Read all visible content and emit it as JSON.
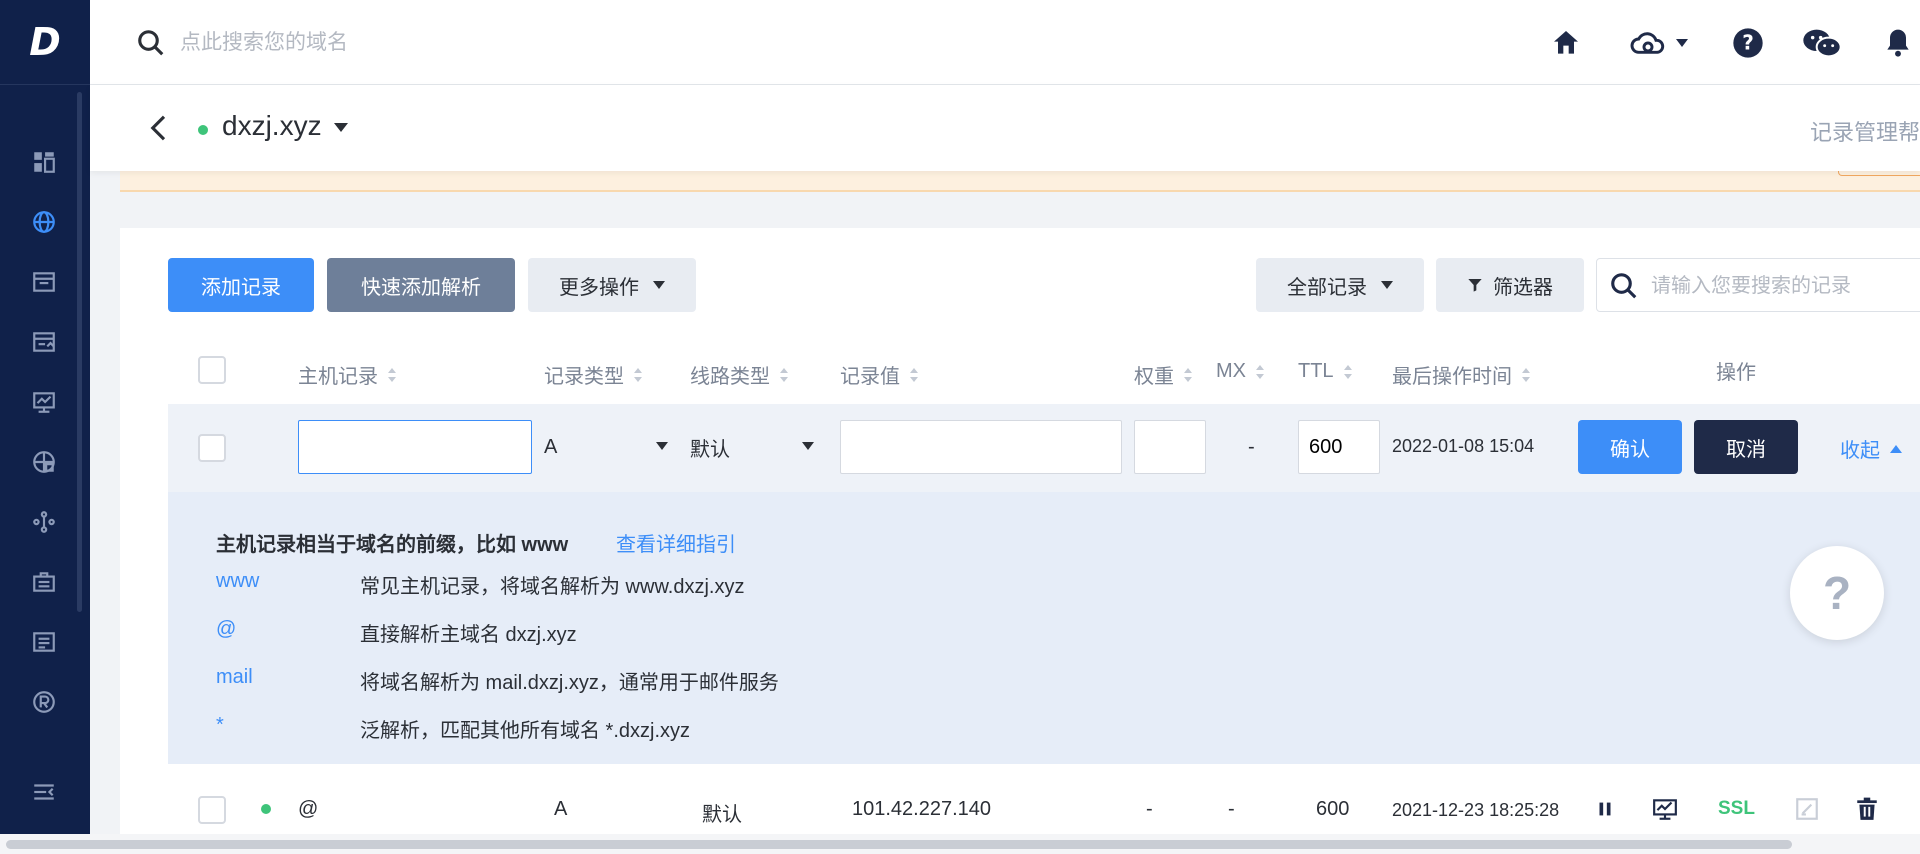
{
  "app": {
    "logo_letter": "D"
  },
  "topbar": {
    "search_placeholder": "点此搜索您的域名"
  },
  "sidebar": {
    "items": [
      {
        "icon": "dashboard-icon",
        "active": false
      },
      {
        "icon": "globe-icon",
        "active": true
      },
      {
        "icon": "window-icon",
        "active": false
      },
      {
        "icon": "browser-icon",
        "active": false
      },
      {
        "icon": "monitor-icon",
        "active": false
      },
      {
        "icon": "global-network-icon",
        "active": false
      },
      {
        "icon": "nodes-icon",
        "active": false
      },
      {
        "icon": "briefcase-icon",
        "active": false
      },
      {
        "icon": "document-icon",
        "active": false
      },
      {
        "icon": "registered-icon",
        "active": false
      },
      {
        "icon": "collapse-menu-icon",
        "active": false
      }
    ]
  },
  "domain": {
    "name": "dxzj.xyz",
    "help": "记录管理帮"
  },
  "toolbar": {
    "add_record": "添加记录",
    "quick_add": "快速添加解析",
    "more_actions": "更多操作",
    "all_records": "全部记录",
    "filter": "筛选器",
    "search_placeholder": "请输入您要搜索的记录"
  },
  "table": {
    "headers": {
      "host": "主机记录",
      "type": "记录类型",
      "line": "线路类型",
      "value": "记录值",
      "weight": "权重",
      "mx": "MX",
      "ttl": "TTL",
      "time": "最后操作时间",
      "actions": "操作"
    },
    "edit_row": {
      "host": "",
      "type": "A",
      "line": "默认",
      "value": "",
      "weight": "",
      "mx": "-",
      "ttl": "600",
      "time": "2022-01-08 15:04",
      "confirm": "确认",
      "cancel": "取消",
      "collapse": "收起"
    },
    "guide": {
      "title": "主机记录相当于域名的前缀，比如 www",
      "link": "查看详细指引",
      "rows": [
        {
          "key": "www",
          "desc": "常见主机记录，将域名解析为 www.dxzj.xyz"
        },
        {
          "key": "@",
          "desc": "直接解析主域名 dxzj.xyz"
        },
        {
          "key": "mail",
          "desc": "将域名解析为 mail.dxzj.xyz，通常用于邮件服务"
        },
        {
          "key": "*",
          "desc": "泛解析，匹配其他所有域名 *.dxzj.xyz"
        }
      ]
    },
    "rows": [
      {
        "status": "enabled",
        "host": "@",
        "type": "A",
        "line": "默认",
        "value": "101.42.227.140",
        "weight": "-",
        "mx": "-",
        "ttl": "600",
        "time": "2021-12-23 18:25:28",
        "ssl": "SSL"
      }
    ]
  },
  "help_bubble": "?",
  "colors": {
    "sidebar": "#10214a",
    "primary": "#3d8ef8",
    "dark_button": "#1f2a48",
    "status_green": "#3ec47a",
    "notice": "#fdf0df"
  }
}
